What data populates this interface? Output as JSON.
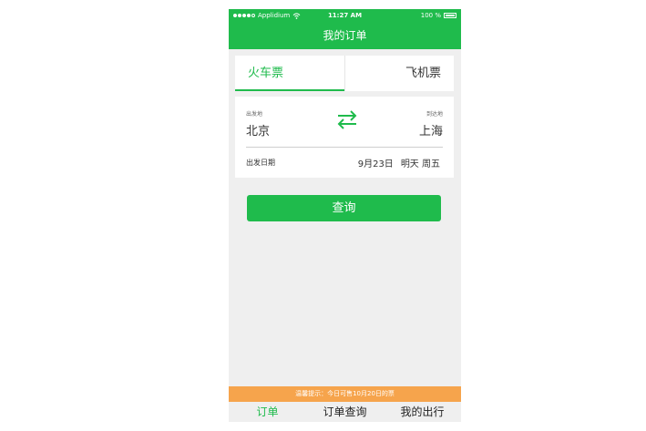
{
  "status_bar": {
    "carrier": "Applidium",
    "time": "11:27 AM",
    "battery": "100 %"
  },
  "nav": {
    "title": "我的订单"
  },
  "tabs": [
    {
      "label": "火车票",
      "active": true
    },
    {
      "label": "飞机票",
      "active": false
    }
  ],
  "route": {
    "from_label": "出发地",
    "from_city": "北京",
    "to_label": "到达地",
    "to_city": "上海"
  },
  "date": {
    "label": "出发日期",
    "date": "9月23日",
    "day": "明天 周五"
  },
  "search_button": "查询",
  "notice": "温馨提示：今日可售10月20日的票",
  "bottom_nav": [
    {
      "label": "订单",
      "active": true
    },
    {
      "label": "订单查询",
      "active": false
    },
    {
      "label": "我的出行",
      "active": false
    }
  ],
  "colors": {
    "primary": "#1fbb4c",
    "notice": "#f6a44c",
    "background": "#efefef"
  }
}
